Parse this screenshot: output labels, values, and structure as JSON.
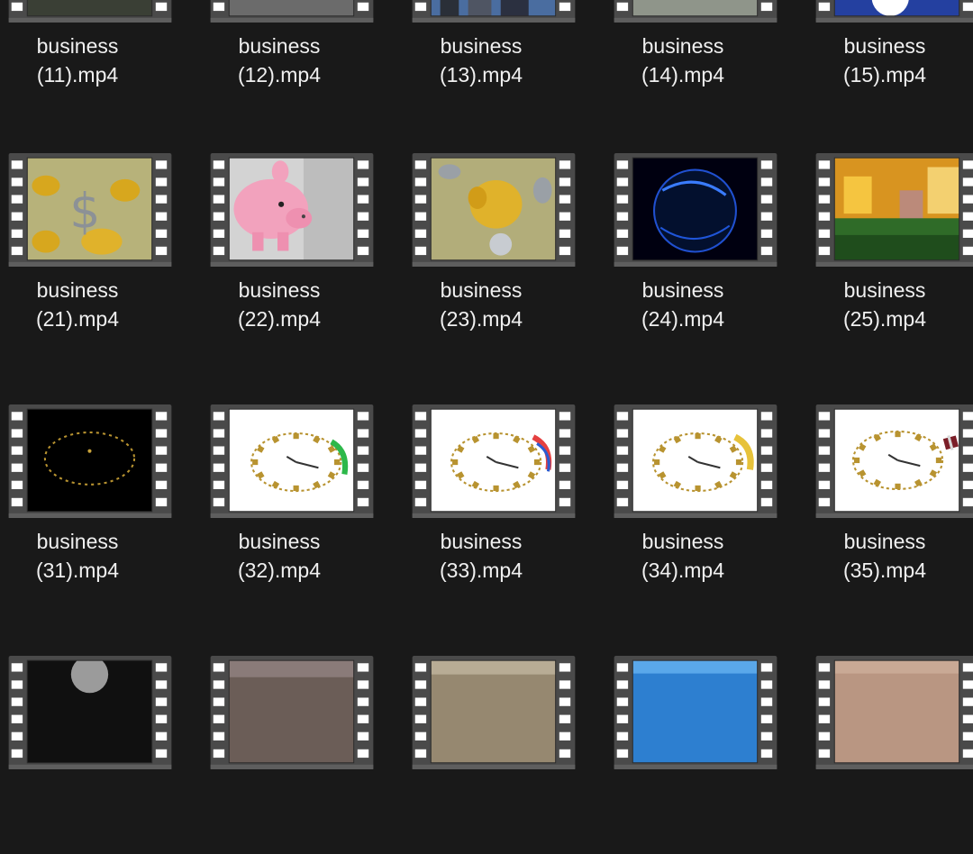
{
  "files": [
    {
      "line1": "business",
      "line2": "(11).mp4",
      "thumb": "dark-forest"
    },
    {
      "line1": "business",
      "line2": "(12).mp4",
      "thumb": "gray"
    },
    {
      "line1": "business",
      "line2": "(13).mp4",
      "thumb": "city"
    },
    {
      "line1": "business",
      "line2": "(14).mp4",
      "thumb": "money"
    },
    {
      "line1": "business",
      "line2": "(15).mp4",
      "thumb": "colorful"
    },
    {
      "line1": "business",
      "line2": "(21).mp4",
      "thumb": "gold-dollar"
    },
    {
      "line1": "business",
      "line2": "(22).mp4",
      "thumb": "piggy-bank"
    },
    {
      "line1": "business",
      "line2": "(23).mp4",
      "thumb": "gold-piggy"
    },
    {
      "line1": "business",
      "line2": "(24).mp4",
      "thumb": "blue-globe"
    },
    {
      "line1": "business",
      "line2": "(25).mp4",
      "thumb": "street"
    },
    {
      "line1": "business",
      "line2": "(31).mp4",
      "thumb": "dark-clock"
    },
    {
      "line1": "business",
      "line2": "(32).mp4",
      "thumb": "clock-green"
    },
    {
      "line1": "business",
      "line2": "(33).mp4",
      "thumb": "clock-red"
    },
    {
      "line1": "business",
      "line2": "(34).mp4",
      "thumb": "clock-yellow"
    },
    {
      "line1": "business",
      "line2": "(35).mp4",
      "thumb": "clock-gift"
    },
    {
      "line1": "",
      "line2": "",
      "thumb": "dark-moon"
    },
    {
      "line1": "",
      "line2": "",
      "thumb": "field"
    },
    {
      "line1": "",
      "line2": "",
      "thumb": "beach"
    },
    {
      "line1": "",
      "line2": "",
      "thumb": "sky"
    },
    {
      "line1": "",
      "line2": "",
      "thumb": "sand"
    }
  ],
  "colors": {
    "background": "#191919",
    "text": "#f0f0f0",
    "film_frame": "#4a4a4a",
    "film_hole": "#ffffff"
  }
}
